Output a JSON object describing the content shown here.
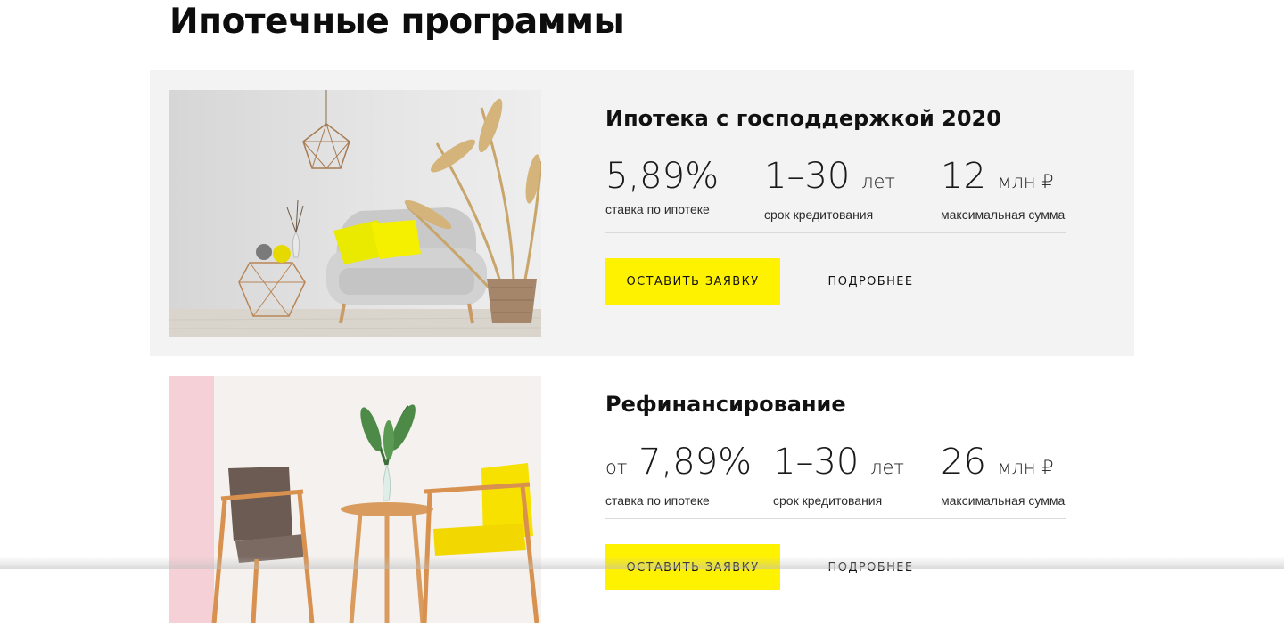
{
  "page": {
    "title": "Ипотечные программы"
  },
  "programs": [
    {
      "title": "Ипотека с господдержкой 2020",
      "rate": {
        "prefix": "",
        "value": "5,89%",
        "caption": "ставка по ипотеке"
      },
      "term": {
        "value": "1–30",
        "unit": "лет",
        "caption": "срок кредитования"
      },
      "amount": {
        "value": "12",
        "unit": "млн ₽",
        "caption": "максимальная сумма"
      },
      "apply_label": "ОСТАВИТЬ ЗАЯВКУ",
      "details_label": "ПОДРОБНЕЕ",
      "image_icon": "living-room-photo"
    },
    {
      "title": "Рефинансирование",
      "rate": {
        "prefix": "от",
        "value": "7,89%",
        "caption": "ставка по ипотеке"
      },
      "term": {
        "value": "1–30",
        "unit": "лет",
        "caption": "срок кредитования"
      },
      "amount": {
        "value": "26",
        "unit": "млн ₽",
        "caption": "максимальная сумма"
      },
      "apply_label": "ОСТАВИТЬ ЗАЯВКУ",
      "details_label": "ПОДРОБНЕЕ",
      "image_icon": "armchairs-photo"
    }
  ],
  "colors": {
    "accent": "#fff200",
    "card_bg": "#f2f3f2"
  }
}
